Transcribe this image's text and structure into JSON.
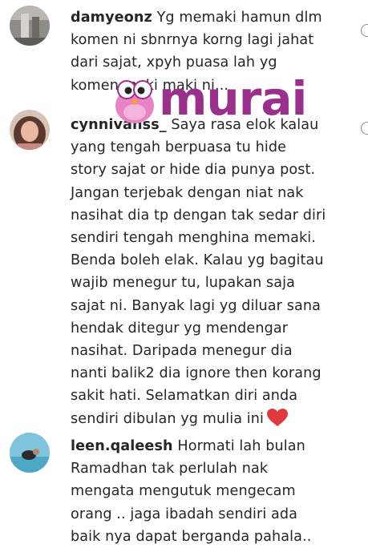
{
  "comments": [
    {
      "username": "damyeonz",
      "text": "Yg memaki hamun dlm\nkomen ni sbnrnya korng lagi jahat\ndari sajat, xpyh puasa lah yg\nkomen maki maki ni..."
    },
    {
      "username": "cynnivanss_",
      "text": "Saya rasa elok kalau\nyang tengah berpuasa tu hide\nstory sajat or hide dia punya post.\nJangan terjebak dengan niat nak\nnasihat dia tp dengan tak sedar diri\nsendiri tengah menghina memaki.\nBenda boleh elak. Kalau yg bagitau\nwajib menegur tu, lupakan saja\nsajat ni. Banyak lagi yg diluar sana\nhendak ditegur yg mendengar\nnasihat. Daripada menegur dia\nnanti balik2 dia ignore then korang\nsakit hati. Selamatkan diri anda\nsendiri dibulan yg mulia ini",
      "emoji": "red-heart-icon"
    },
    {
      "username": "leen.qaleesh",
      "text": "Hormati lah bulan\nRamadhan tak perlulah nak\nmengata mengutuk mengecam\norang .. jaga ibadah sendiri ada\nbaik nya dapat berganda pahala.."
    }
  ],
  "watermark": {
    "text": "murai",
    "color": "#9b2f8c"
  }
}
